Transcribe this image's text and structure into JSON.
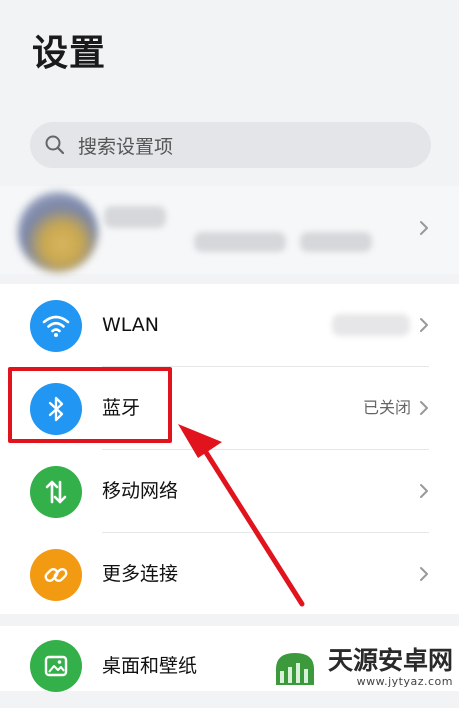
{
  "header": {
    "title": "设置"
  },
  "search": {
    "placeholder": "搜索设置项",
    "icon": "search-icon"
  },
  "connectivity": {
    "items": [
      {
        "label": "WLAN",
        "value": "",
        "icon": "wifi-icon",
        "color": "#2196f3"
      },
      {
        "label": "蓝牙",
        "value": "已关闭",
        "icon": "bluetooth-icon",
        "color": "#2196f3"
      },
      {
        "label": "移动网络",
        "value": "",
        "icon": "mobile-data-icon",
        "color": "#34b04a"
      },
      {
        "label": "更多连接",
        "value": "",
        "icon": "link-icon",
        "color": "#f29a12"
      }
    ]
  },
  "display": {
    "items": [
      {
        "label": "桌面和壁纸",
        "icon": "wallpaper-icon",
        "color": "#34b04a"
      }
    ]
  },
  "watermark": {
    "name": "天源安卓网",
    "url": "www.jytyaz.com"
  },
  "colors": {
    "highlight": "#e1141e",
    "background": "#f1f3f5"
  }
}
